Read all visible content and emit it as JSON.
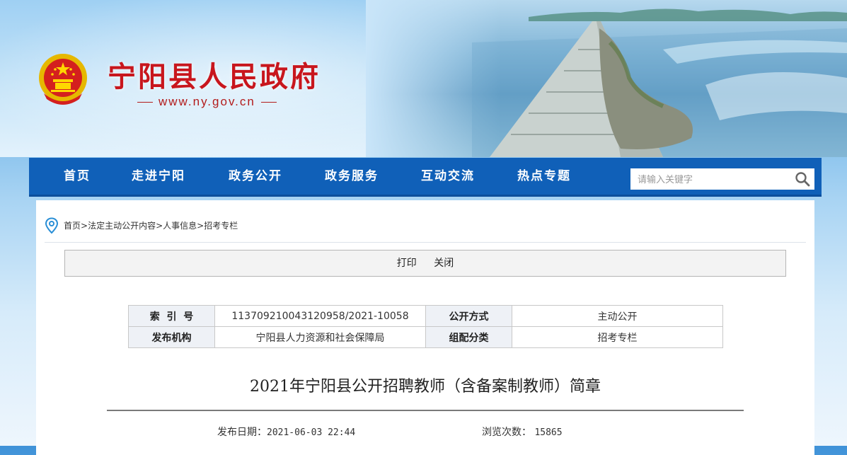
{
  "header": {
    "site_title": "宁阳县人民政府",
    "site_url": "www.ny.gov.cn",
    "emblem": "national-emblem-icon"
  },
  "nav": {
    "items": [
      "首页",
      "走进宁阳",
      "政务公开",
      "政务服务",
      "互动交流",
      "热点专题"
    ],
    "search_placeholder": "请输入关键字"
  },
  "breadcrumb": {
    "items": [
      "首页",
      "法定主动公开内容",
      "人事信息",
      "招考专栏"
    ],
    "separator": ">"
  },
  "toolbar": {
    "print": "打印",
    "close": "关闭"
  },
  "meta": {
    "index_label": "索  引  号",
    "index_value": "113709210043120958/2021-10058",
    "open_mode_label": "公开方式",
    "open_mode_value": "主动公开",
    "publisher_label": "发布机构",
    "publisher_value": "宁阳县人力资源和社会保障局",
    "category_label": "组配分类",
    "category_value": "招考专栏"
  },
  "article": {
    "title": "2021年宁阳县公开招聘教师（含备案制教师）简章",
    "date_label": "发布日期：",
    "date_value": "2021-06-03 22:44",
    "views_label": "浏览次数：",
    "views_value": "15865"
  },
  "colors": {
    "nav_bg": "#1060b8",
    "title_red": "#c8161d",
    "panel_bg": "#ffffff"
  }
}
